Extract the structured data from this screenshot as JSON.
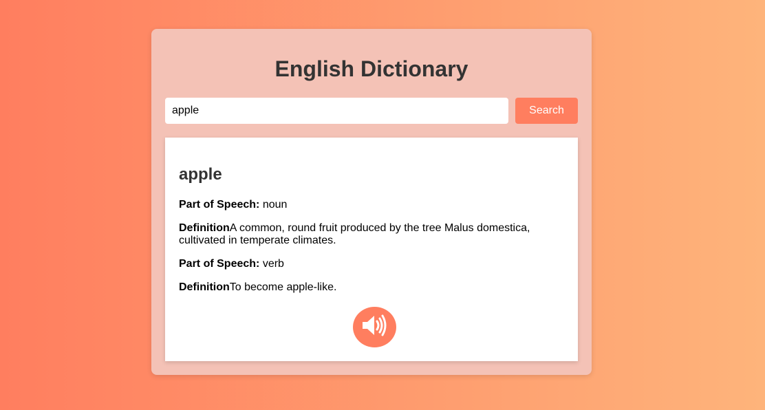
{
  "app": {
    "title": "English Dictionary"
  },
  "search": {
    "value": "apple",
    "placeholder": "",
    "button_label": "Search"
  },
  "result": {
    "word": "apple",
    "entries": [
      {
        "pos_label": "Part of Speech:",
        "pos_value": "noun",
        "def_label": "Definition",
        "def_value": "A common, round fruit produced by the tree Malus domestica, cultivated in temperate climates."
      },
      {
        "pos_label": "Part of Speech:",
        "pos_value": "verb",
        "def_label": "Definition",
        "def_value": "To become apple-like."
      }
    ],
    "audio_icon": "speaker-volume-icon"
  },
  "colors": {
    "accent": "#ff7e5f",
    "gradient_end": "#feb47b",
    "panel": "#f4c2b6",
    "heading": "#333333"
  }
}
